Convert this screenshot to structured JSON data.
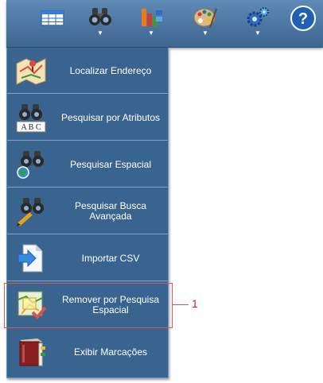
{
  "toolbar": {
    "buttons": [
      {
        "name": "table-button",
        "icon": "table-icon",
        "dropdown": false
      },
      {
        "name": "search-button",
        "icon": "binoculars-icon",
        "dropdown": true,
        "arrow": "▼"
      },
      {
        "name": "layers-button",
        "icon": "layers-chart-icon",
        "dropdown": true,
        "arrow": "▼"
      },
      {
        "name": "palette-button",
        "icon": "palette-icon",
        "dropdown": true,
        "arrow": "▼"
      },
      {
        "name": "settings-button",
        "icon": "gears-icon",
        "dropdown": true,
        "arrow": "▼"
      },
      {
        "name": "help-button",
        "icon": "help-icon",
        "label": "?",
        "dropdown": false
      }
    ]
  },
  "menu": {
    "items": [
      {
        "label": "Localizar Endereço",
        "icon": "map-icon"
      },
      {
        "label": "Pesquisar por Atributos",
        "icon": "binoculars-abc-icon"
      },
      {
        "label": "Pesquisar Espacial",
        "icon": "binoculars-globe-icon"
      },
      {
        "label": "Pesquisar Busca Avançada",
        "icon": "binoculars-pencil-icon"
      },
      {
        "label": "Importar CSV",
        "icon": "import-file-icon"
      },
      {
        "label": "Remover por Pesquisa Espacial",
        "icon": "remove-spatial-icon"
      },
      {
        "label": "Exibir Marcações",
        "icon": "book-icon"
      }
    ]
  },
  "annotation": {
    "label": "1",
    "color": "#d9535a"
  },
  "colors": {
    "toolbar": "#4a73a0",
    "menu": "#3a6490",
    "separator": "#7fa3c6"
  }
}
